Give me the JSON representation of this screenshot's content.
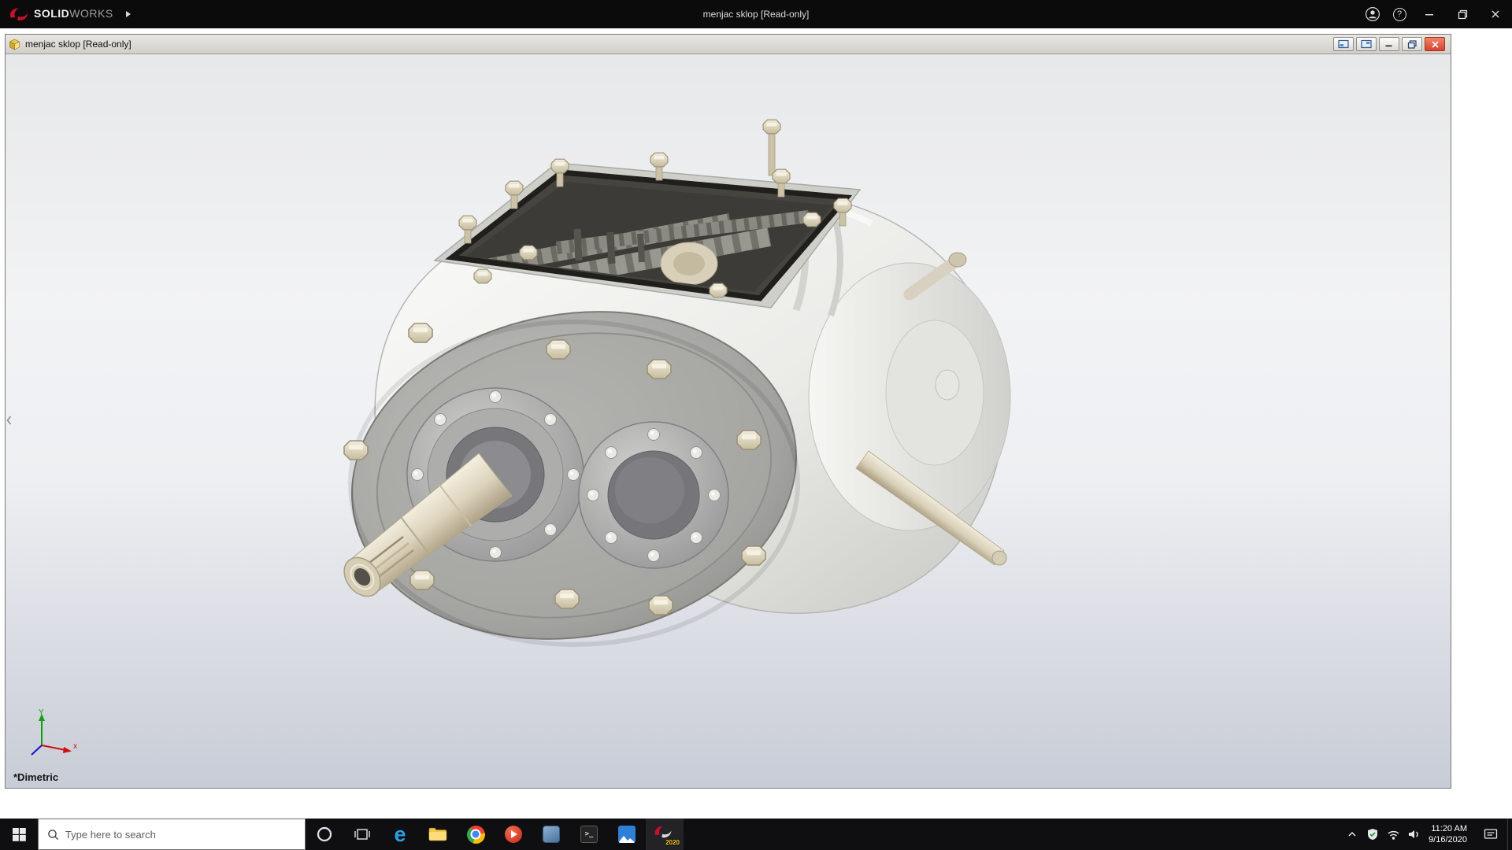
{
  "app_titlebar": {
    "brand_solid": "SOLID",
    "brand_works": "WORKS",
    "document_title": "menjac sklop [Read-only]",
    "help_glyph": "?"
  },
  "doc_window": {
    "title": "menjac sklop [Read-only]"
  },
  "viewport": {
    "orientation_label": "*Dimetric",
    "triad_y_label": "Y",
    "triad_x_label": "x"
  },
  "taskbar": {
    "search_placeholder": "Type here to search",
    "edge_glyph": "e",
    "terminal_glyph": ">_",
    "solidworks_badge": "2020",
    "time": "11:20 AM",
    "date": "9/16/2020"
  },
  "icons": {
    "app_logo": "solidworks-ds-swoosh",
    "window_controls": [
      "account",
      "help",
      "minimize",
      "restore",
      "close"
    ],
    "doc_controls": [
      "tile-left",
      "tile-right",
      "minimize",
      "restore",
      "close"
    ],
    "taskbar_apps": [
      "start",
      "cortana",
      "task-view",
      "edge",
      "file-explorer",
      "chrome",
      "media-player",
      "edrawings",
      "command-prompt",
      "photos",
      "solidworks-2020"
    ],
    "tray": [
      "hidden-icons-chevron",
      "security-shield",
      "wifi-network",
      "volume",
      "action-center"
    ]
  },
  "colors": {
    "brand_red": "#c8102e",
    "close_red": "#d9432f",
    "badge_yellow": "#f5c518",
    "taskbar_bg": "#0f0f11"
  }
}
